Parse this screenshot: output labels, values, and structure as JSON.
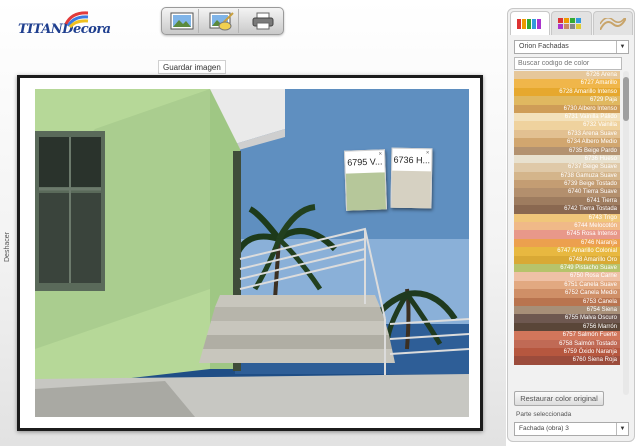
{
  "logo": {
    "text": "TITANDecora"
  },
  "toolbar": {
    "buttons": [
      {
        "icon": "picture-icon"
      },
      {
        "icon": "paint-picture-icon"
      },
      {
        "icon": "printer-icon"
      }
    ]
  },
  "tooltip": {
    "text": "Guardar imagen"
  },
  "sidebar_left": {
    "undo_label": "Deshacer"
  },
  "swatches": [
    {
      "label": "6795 V...",
      "color": "#b6c79a"
    },
    {
      "label": "6736 H...",
      "color": "#d6d1c2"
    }
  ],
  "panel": {
    "tabs": [
      {
        "icon": "color-stripes-icon"
      },
      {
        "icon": "color-grid-icon"
      },
      {
        "icon": "pattern-icon"
      }
    ],
    "collection": "Orion Fachadas",
    "search_placeholder": "Buscar codigo de color",
    "colors": [
      {
        "label": "6726 Arena",
        "color": "#e6c79a"
      },
      {
        "label": "6727 Amarillo",
        "color": "#f0b64a"
      },
      {
        "label": "6728 Amarillo Intenso",
        "color": "#e6a82e"
      },
      {
        "label": "6729 Paja",
        "color": "#e0b860"
      },
      {
        "label": "6730 Albero Intenso",
        "color": "#cf9d57"
      },
      {
        "label": "6731 Vainilla Pálido",
        "color": "#f3e1bb"
      },
      {
        "label": "6732 Vainilla",
        "color": "#efd29e"
      },
      {
        "label": "6733 Arena Suave",
        "color": "#e2c091"
      },
      {
        "label": "6734 Albero Medio",
        "color": "#d1a66f"
      },
      {
        "label": "6735 Beige Pardo",
        "color": "#b39270"
      },
      {
        "label": "6736 Hueso",
        "color": "#e8e1cf"
      },
      {
        "label": "6737 Beige Suave",
        "color": "#dfc9a8"
      },
      {
        "label": "6738 Gamuza Suave",
        "color": "#d4b58b"
      },
      {
        "label": "6739 Beige Tostado",
        "color": "#c49d73"
      },
      {
        "label": "6740 Tierra Suave",
        "color": "#b38f6d"
      },
      {
        "label": "6741 Tierra",
        "color": "#9e7c5f"
      },
      {
        "label": "6742 Tierra Tostada",
        "color": "#8a6850"
      },
      {
        "label": "6743 Trigo",
        "color": "#f0c67a"
      },
      {
        "label": "6744 Melocotón",
        "color": "#f0b988"
      },
      {
        "label": "6745 Rosa Intenso",
        "color": "#e8988a"
      },
      {
        "label": "6746 Naranja",
        "color": "#eca04e"
      },
      {
        "label": "6747 Amarillo Colonial",
        "color": "#e8b840"
      },
      {
        "label": "6748 Amarillo Oro",
        "color": "#d9a935"
      },
      {
        "label": "6749 Pistacho Suave",
        "color": "#b7c36b"
      },
      {
        "label": "6750 Rosa Carne",
        "color": "#efc1a6"
      },
      {
        "label": "6751 Canela Suave",
        "color": "#e2a981"
      },
      {
        "label": "6752 Canela Medio",
        "color": "#cf8f67"
      },
      {
        "label": "6753 Canela",
        "color": "#b9744f"
      },
      {
        "label": "6754 Siena",
        "color": "#a78f78"
      },
      {
        "label": "6755 Malva Oscuro",
        "color": "#6e5850"
      },
      {
        "label": "6756 Marrón",
        "color": "#5a4638"
      },
      {
        "label": "6757 Salmón Fuerte",
        "color": "#d1765b"
      },
      {
        "label": "6758 Salmón Tostado",
        "color": "#c06a55"
      },
      {
        "label": "6759 Óxido Naranja",
        "color": "#b6573f"
      },
      {
        "label": "6760 Siena Roja",
        "color": "#9c4c3c"
      }
    ],
    "restore_label": "Restaurar color original",
    "part_label": "Parte seleccionada",
    "part_value": "Fachada (obra) 3"
  }
}
